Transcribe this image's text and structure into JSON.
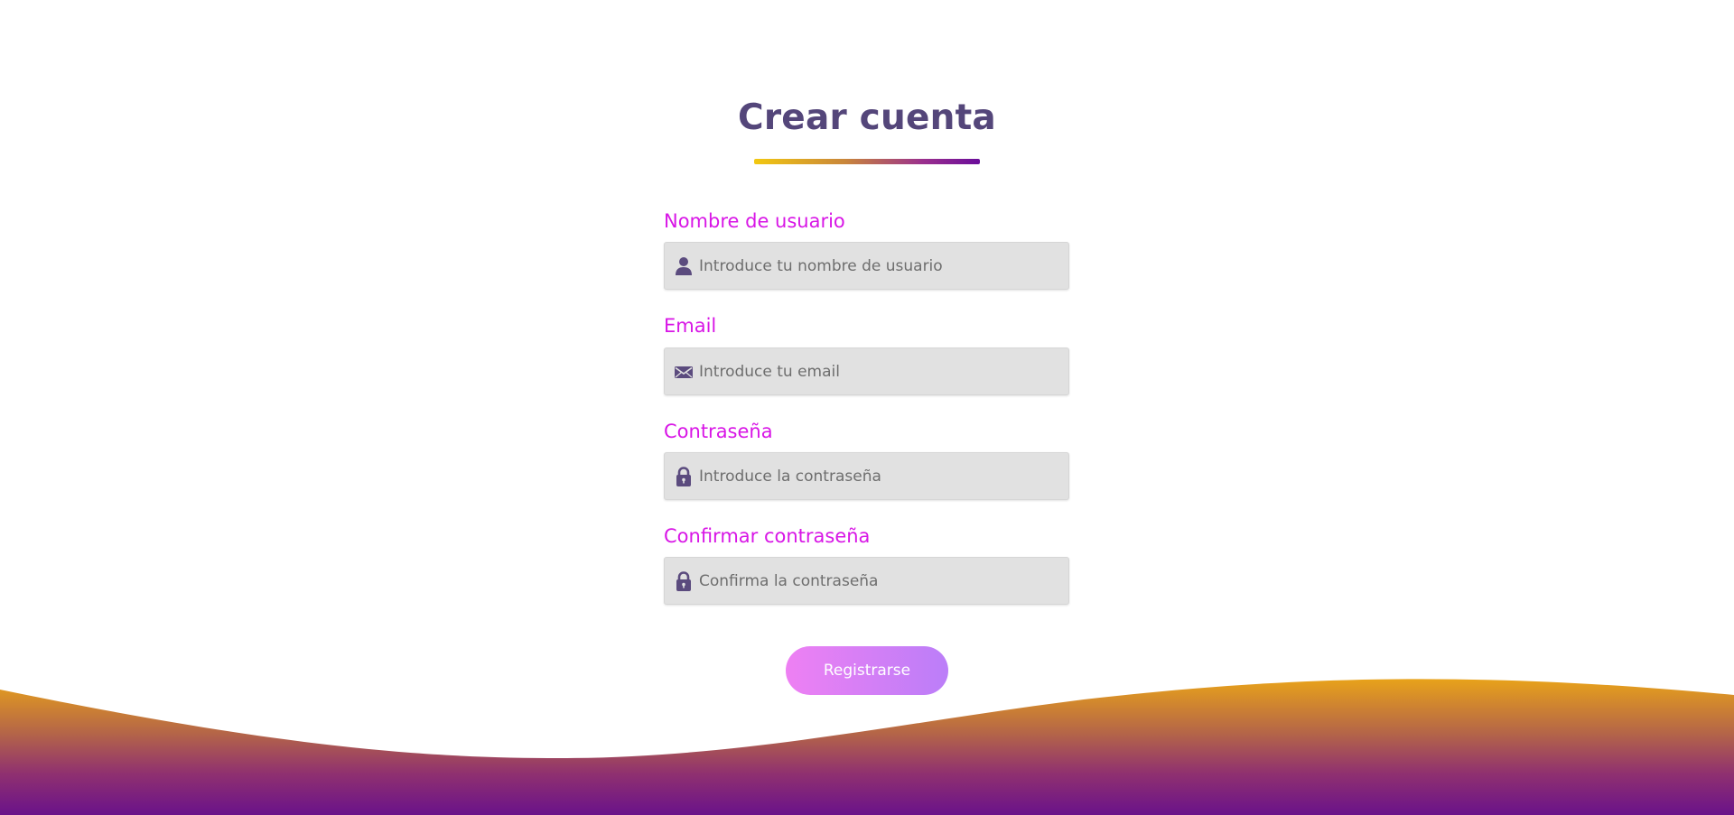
{
  "title": "Crear cuenta",
  "colors": {
    "title": "#54467a",
    "label": "#d816e6",
    "icon": "#5b4b7e",
    "underline_start": "#f2c811",
    "underline_end": "#6a0d9a",
    "button_start": "#ee80f3",
    "button_end": "#bb7ef8",
    "wave_top": "#e8a21a",
    "wave_bottom": "#6a128a"
  },
  "fields": [
    {
      "label": "Nombre de usuario",
      "placeholder": "Introduce tu nombre de usuario",
      "value": "",
      "icon": "user-icon"
    },
    {
      "label": "Email",
      "placeholder": "Introduce tu email",
      "value": "",
      "icon": "envelope-icon"
    },
    {
      "label": "Contraseña",
      "placeholder": "Introduce la contraseña",
      "value": "",
      "icon": "lock-icon"
    },
    {
      "label": "Confirmar contraseña",
      "placeholder": "Confirma la contraseña",
      "value": "",
      "icon": "lock-icon"
    }
  ],
  "submit_label": "Registrarse"
}
